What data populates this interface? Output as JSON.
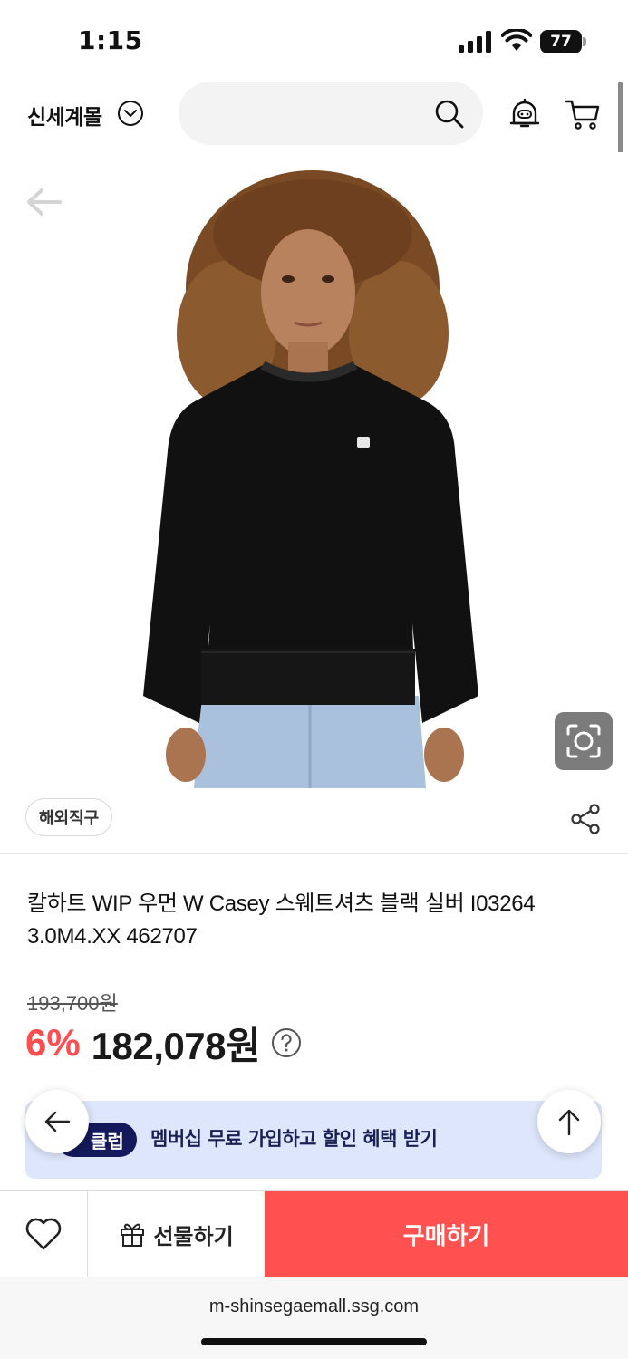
{
  "status_bar": {
    "time": "1:15",
    "battery_level": "77"
  },
  "header": {
    "mall_name": "신세계몰",
    "search_placeholder": "",
    "icons": [
      "chevron-down-icon",
      "search-icon",
      "bell-icon",
      "cart-icon"
    ]
  },
  "product": {
    "badge": "해외직구",
    "name": "칼하트 WIP 우먼 W Casey 스웨트셔츠 블랙 실버 I03264 3.0M4.XX 462707",
    "original_price": "193,700원",
    "discount_rate": "6%",
    "sale_price": "182,078원",
    "image_icon": "carhartt-logo"
  },
  "membership_banner": {
    "badge_label": "클럽",
    "text": "멤버십 무료 가입하고 할인 혜택 받기"
  },
  "action_bar": {
    "gift_label": "선물하기",
    "buy_label": "구매하기"
  },
  "browser": {
    "url": "m-shinsegaemall.ssg.com"
  },
  "colors": {
    "accent_red": "#ff5150",
    "discount_red": "#ff4d50",
    "banner_bg": "#dde6fa",
    "banner_badge": "#13195a"
  }
}
